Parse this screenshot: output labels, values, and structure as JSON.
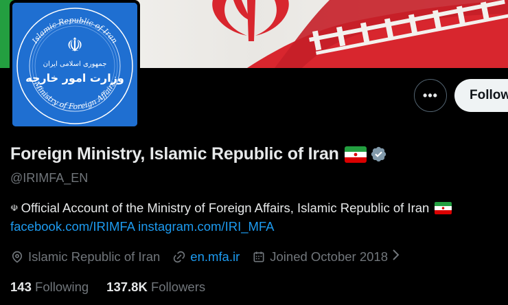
{
  "profile": {
    "display_name": "Foreign Ministry, Islamic Republic of Iran",
    "handle": "@IRIMFA_EN",
    "bio": "Official Account of the Ministry of Foreign Affairs, Islamic Republic of Iran",
    "bio_prefix_glyph": "☫",
    "links": [
      "facebook.com/IRIMFA",
      "instagram.com/IRI_MFA"
    ],
    "location": "Islamic Republic of Iran",
    "website": "en.mfa.ir",
    "joined": "Joined October 2018",
    "following_count": "143",
    "following_label": "Following",
    "followers_count": "137.8K",
    "followers_label": "Followers"
  },
  "buttons": {
    "more_label": "•••",
    "follow_label": "Follow"
  },
  "avatar": {
    "text_top": "Islamic Republic of Iran",
    "text_bottom": "Ministry of Foreign Affairs",
    "text_fa_1": "جمهوری اسلامی ایران",
    "text_fa_2": "وزارت امور خارجه",
    "emblem": "☫"
  },
  "colors": {
    "background": "#000000",
    "text": "#e7e9ea",
    "muted": "#71767b",
    "link": "#1d9bf0",
    "badge": "#829aab",
    "avatar_blue": "#1f6fd1",
    "flag_green": "#239f40",
    "flag_red": "#da0000"
  },
  "icons": {
    "verified": "verified-badge-icon",
    "location": "location-pin-icon",
    "link": "link-icon",
    "calendar": "calendar-icon",
    "chevron": "chevron-right-icon",
    "flag": "iran-flag-icon"
  }
}
